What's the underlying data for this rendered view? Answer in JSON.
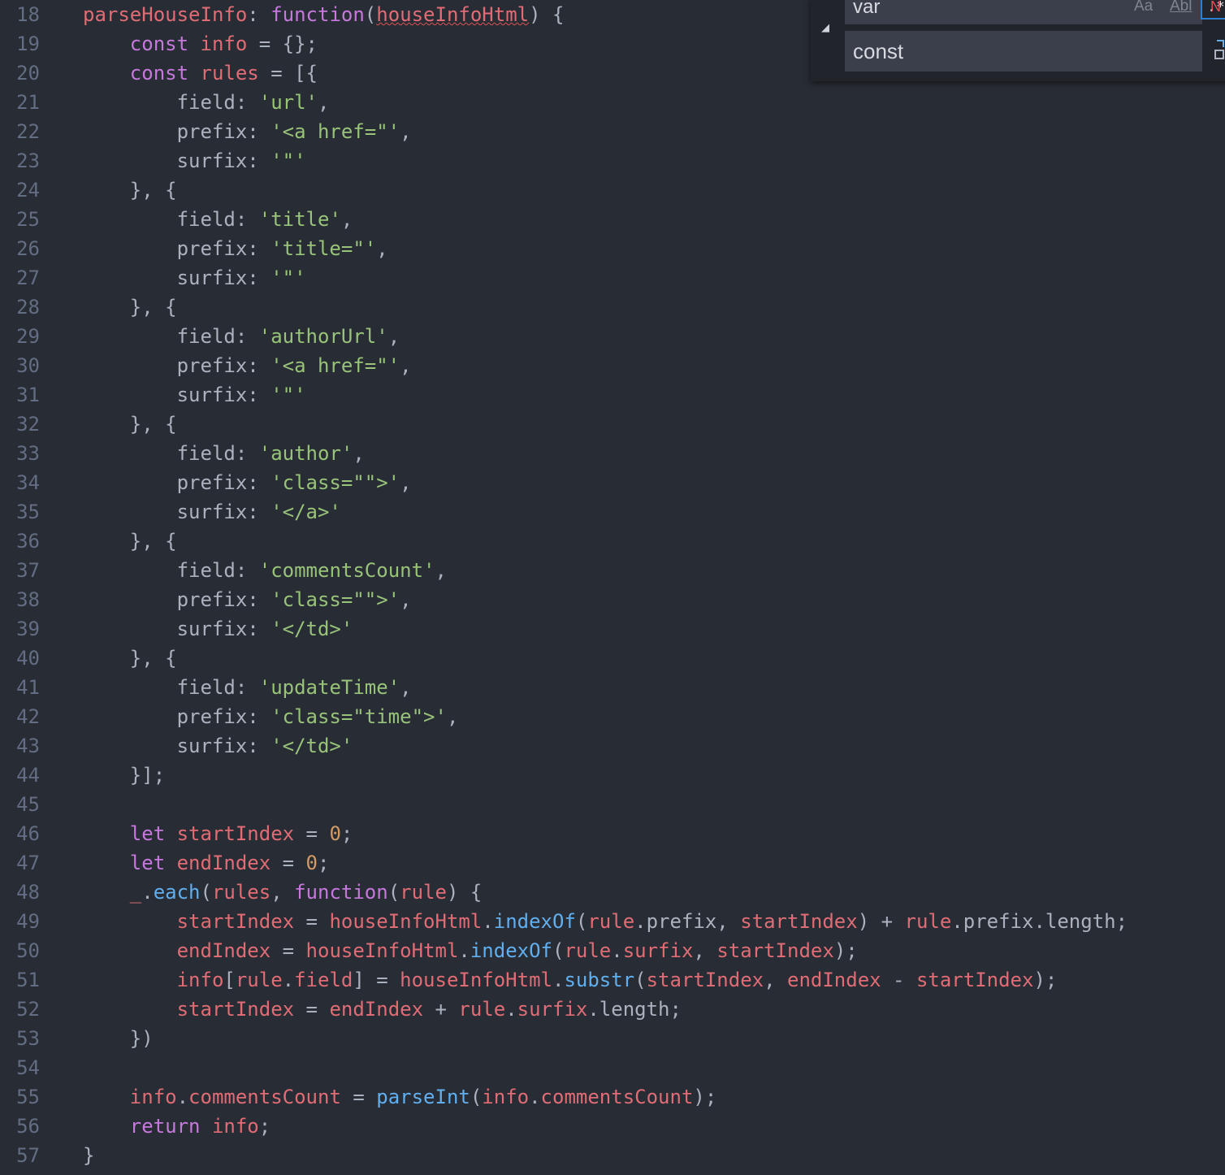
{
  "find_widget": {
    "find_value": "var",
    "replace_value": "const",
    "match_case_label": "Aa",
    "whole_word_label": "Abl",
    "regex_label": ".*",
    "toggle_replace_glyph": "◢",
    "close_glyph": "N"
  },
  "editor": {
    "lines": [
      {
        "n": "18",
        "t": [
          [
            "v",
            "parseHouseInfo"
          ],
          [
            "p",
            ": "
          ],
          [
            "k",
            "function"
          ],
          [
            "p",
            "("
          ],
          [
            "v",
            "houseInfoHtml",
            true
          ],
          [
            "p",
            ") {"
          ]
        ]
      },
      {
        "n": "19",
        "t": [
          [
            "p",
            "    "
          ],
          [
            "k",
            "const "
          ],
          [
            "v",
            "info"
          ],
          [
            "p",
            " = {};"
          ]
        ]
      },
      {
        "n": "20",
        "t": [
          [
            "p",
            "    "
          ],
          [
            "k",
            "const "
          ],
          [
            "v",
            "rules"
          ],
          [
            "p",
            " = [{"
          ]
        ]
      },
      {
        "n": "21",
        "t": [
          [
            "p",
            "        field: "
          ],
          [
            "s",
            "'url'"
          ],
          [
            "p",
            ","
          ]
        ]
      },
      {
        "n": "22",
        "t": [
          [
            "p",
            "        prefix: "
          ],
          [
            "s",
            "'<a href=\"'"
          ],
          [
            "p",
            ","
          ]
        ]
      },
      {
        "n": "23",
        "t": [
          [
            "p",
            "        surfix: "
          ],
          [
            "s",
            "'\"'"
          ]
        ]
      },
      {
        "n": "24",
        "t": [
          [
            "p",
            "    }, {"
          ]
        ]
      },
      {
        "n": "25",
        "t": [
          [
            "p",
            "        field: "
          ],
          [
            "s",
            "'title'"
          ],
          [
            "p",
            ","
          ]
        ]
      },
      {
        "n": "26",
        "t": [
          [
            "p",
            "        prefix: "
          ],
          [
            "s",
            "'title=\"'"
          ],
          [
            "p",
            ","
          ]
        ]
      },
      {
        "n": "27",
        "t": [
          [
            "p",
            "        surfix: "
          ],
          [
            "s",
            "'\"'"
          ]
        ]
      },
      {
        "n": "28",
        "t": [
          [
            "p",
            "    }, {"
          ]
        ]
      },
      {
        "n": "29",
        "t": [
          [
            "p",
            "        field: "
          ],
          [
            "s",
            "'authorUrl'"
          ],
          [
            "p",
            ","
          ]
        ]
      },
      {
        "n": "30",
        "t": [
          [
            "p",
            "        prefix: "
          ],
          [
            "s",
            "'<a href=\"'"
          ],
          [
            "p",
            ","
          ]
        ]
      },
      {
        "n": "31",
        "t": [
          [
            "p",
            "        surfix: "
          ],
          [
            "s",
            "'\"'"
          ]
        ]
      },
      {
        "n": "32",
        "t": [
          [
            "p",
            "    }, {"
          ]
        ]
      },
      {
        "n": "33",
        "t": [
          [
            "p",
            "        field: "
          ],
          [
            "s",
            "'author'"
          ],
          [
            "p",
            ","
          ]
        ]
      },
      {
        "n": "34",
        "t": [
          [
            "p",
            "        prefix: "
          ],
          [
            "s",
            "'class=\"\">'"
          ],
          [
            "p",
            ","
          ]
        ]
      },
      {
        "n": "35",
        "t": [
          [
            "p",
            "        surfix: "
          ],
          [
            "s",
            "'</a>'"
          ]
        ]
      },
      {
        "n": "36",
        "t": [
          [
            "p",
            "    }, {"
          ]
        ]
      },
      {
        "n": "37",
        "t": [
          [
            "p",
            "        field: "
          ],
          [
            "s",
            "'commentsCount'"
          ],
          [
            "p",
            ","
          ]
        ]
      },
      {
        "n": "38",
        "t": [
          [
            "p",
            "        prefix: "
          ],
          [
            "s",
            "'class=\"\">'"
          ],
          [
            "p",
            ","
          ]
        ]
      },
      {
        "n": "39",
        "t": [
          [
            "p",
            "        surfix: "
          ],
          [
            "s",
            "'</td>'"
          ]
        ]
      },
      {
        "n": "40",
        "t": [
          [
            "p",
            "    }, {"
          ]
        ]
      },
      {
        "n": "41",
        "t": [
          [
            "p",
            "        field: "
          ],
          [
            "s",
            "'updateTime'"
          ],
          [
            "p",
            ","
          ]
        ]
      },
      {
        "n": "42",
        "t": [
          [
            "p",
            "        prefix: "
          ],
          [
            "s",
            "'class=\"time\">'"
          ],
          [
            "p",
            ","
          ]
        ]
      },
      {
        "n": "43",
        "t": [
          [
            "p",
            "        surfix: "
          ],
          [
            "s",
            "'</td>'"
          ]
        ]
      },
      {
        "n": "44",
        "t": [
          [
            "p",
            "    }];"
          ]
        ]
      },
      {
        "n": "45",
        "t": []
      },
      {
        "n": "46",
        "t": [
          [
            "p",
            "    "
          ],
          [
            "k",
            "let "
          ],
          [
            "v",
            "startIndex"
          ],
          [
            "p",
            " = "
          ],
          [
            "n",
            "0"
          ],
          [
            "p",
            ";"
          ]
        ]
      },
      {
        "n": "47",
        "t": [
          [
            "p",
            "    "
          ],
          [
            "k",
            "let "
          ],
          [
            "v",
            "endIndex"
          ],
          [
            "p",
            " = "
          ],
          [
            "n",
            "0"
          ],
          [
            "p",
            ";"
          ]
        ]
      },
      {
        "n": "48",
        "t": [
          [
            "p",
            "    "
          ],
          [
            "v",
            "_"
          ],
          [
            "p",
            "."
          ],
          [
            "f",
            "each"
          ],
          [
            "p",
            "("
          ],
          [
            "v",
            "rules"
          ],
          [
            "p",
            ", "
          ],
          [
            "k",
            "function"
          ],
          [
            "p",
            "("
          ],
          [
            "v",
            "rule"
          ],
          [
            "p",
            ") {"
          ]
        ]
      },
      {
        "n": "49",
        "t": [
          [
            "p",
            "        "
          ],
          [
            "v",
            "startIndex"
          ],
          [
            "p",
            " = "
          ],
          [
            "v",
            "houseInfoHtml"
          ],
          [
            "p",
            "."
          ],
          [
            "f",
            "indexOf"
          ],
          [
            "p",
            "("
          ],
          [
            "v",
            "rule"
          ],
          [
            "p",
            ".prefix, "
          ],
          [
            "v",
            "startIndex"
          ],
          [
            "p",
            ") + "
          ],
          [
            "v",
            "rule"
          ],
          [
            "p",
            ".prefix.length;"
          ]
        ]
      },
      {
        "n": "50",
        "t": [
          [
            "p",
            "        "
          ],
          [
            "v",
            "endIndex"
          ],
          [
            "p",
            " = "
          ],
          [
            "v",
            "houseInfoHtml"
          ],
          [
            "p",
            "."
          ],
          [
            "f",
            "indexOf"
          ],
          [
            "p",
            "("
          ],
          [
            "v",
            "rule"
          ],
          [
            "p",
            "."
          ],
          [
            "v",
            "surfix"
          ],
          [
            "p",
            ", "
          ],
          [
            "v",
            "startIndex"
          ],
          [
            "p",
            ");"
          ]
        ]
      },
      {
        "n": "51",
        "t": [
          [
            "p",
            "        "
          ],
          [
            "v",
            "info"
          ],
          [
            "p",
            "["
          ],
          [
            "v",
            "rule"
          ],
          [
            "p",
            "."
          ],
          [
            "v",
            "field"
          ],
          [
            "p",
            "] = "
          ],
          [
            "v",
            "houseInfoHtml"
          ],
          [
            "p",
            "."
          ],
          [
            "f",
            "substr"
          ],
          [
            "p",
            "("
          ],
          [
            "v",
            "startIndex"
          ],
          [
            "p",
            ", "
          ],
          [
            "v",
            "endIndex"
          ],
          [
            "p",
            " - "
          ],
          [
            "v",
            "startIndex"
          ],
          [
            "p",
            ");"
          ]
        ]
      },
      {
        "n": "52",
        "t": [
          [
            "p",
            "        "
          ],
          [
            "v",
            "startIndex"
          ],
          [
            "p",
            " = "
          ],
          [
            "v",
            "endIndex"
          ],
          [
            "p",
            " + "
          ],
          [
            "v",
            "rule"
          ],
          [
            "p",
            "."
          ],
          [
            "v",
            "surfix"
          ],
          [
            "p",
            ".length;"
          ]
        ]
      },
      {
        "n": "53",
        "t": [
          [
            "p",
            "    })"
          ]
        ]
      },
      {
        "n": "54",
        "t": []
      },
      {
        "n": "55",
        "t": [
          [
            "p",
            "    "
          ],
          [
            "v",
            "info"
          ],
          [
            "p",
            "."
          ],
          [
            "v",
            "commentsCount"
          ],
          [
            "p",
            " = "
          ],
          [
            "f",
            "parseInt"
          ],
          [
            "p",
            "("
          ],
          [
            "v",
            "info"
          ],
          [
            "p",
            "."
          ],
          [
            "v",
            "commentsCount"
          ],
          [
            "p",
            ");"
          ]
        ]
      },
      {
        "n": "56",
        "t": [
          [
            "p",
            "    "
          ],
          [
            "k",
            "return "
          ],
          [
            "v",
            "info"
          ],
          [
            "p",
            ";"
          ]
        ]
      },
      {
        "n": "57",
        "t": [
          [
            "p",
            "}"
          ]
        ]
      }
    ]
  },
  "colors": {
    "background": "#282c34",
    "keyword": "#c678dd",
    "variable": "#e06c75",
    "string": "#98c379",
    "number": "#d19a66",
    "function": "#61afef",
    "punctuation": "#abb2bf",
    "line_number": "#636d83"
  }
}
